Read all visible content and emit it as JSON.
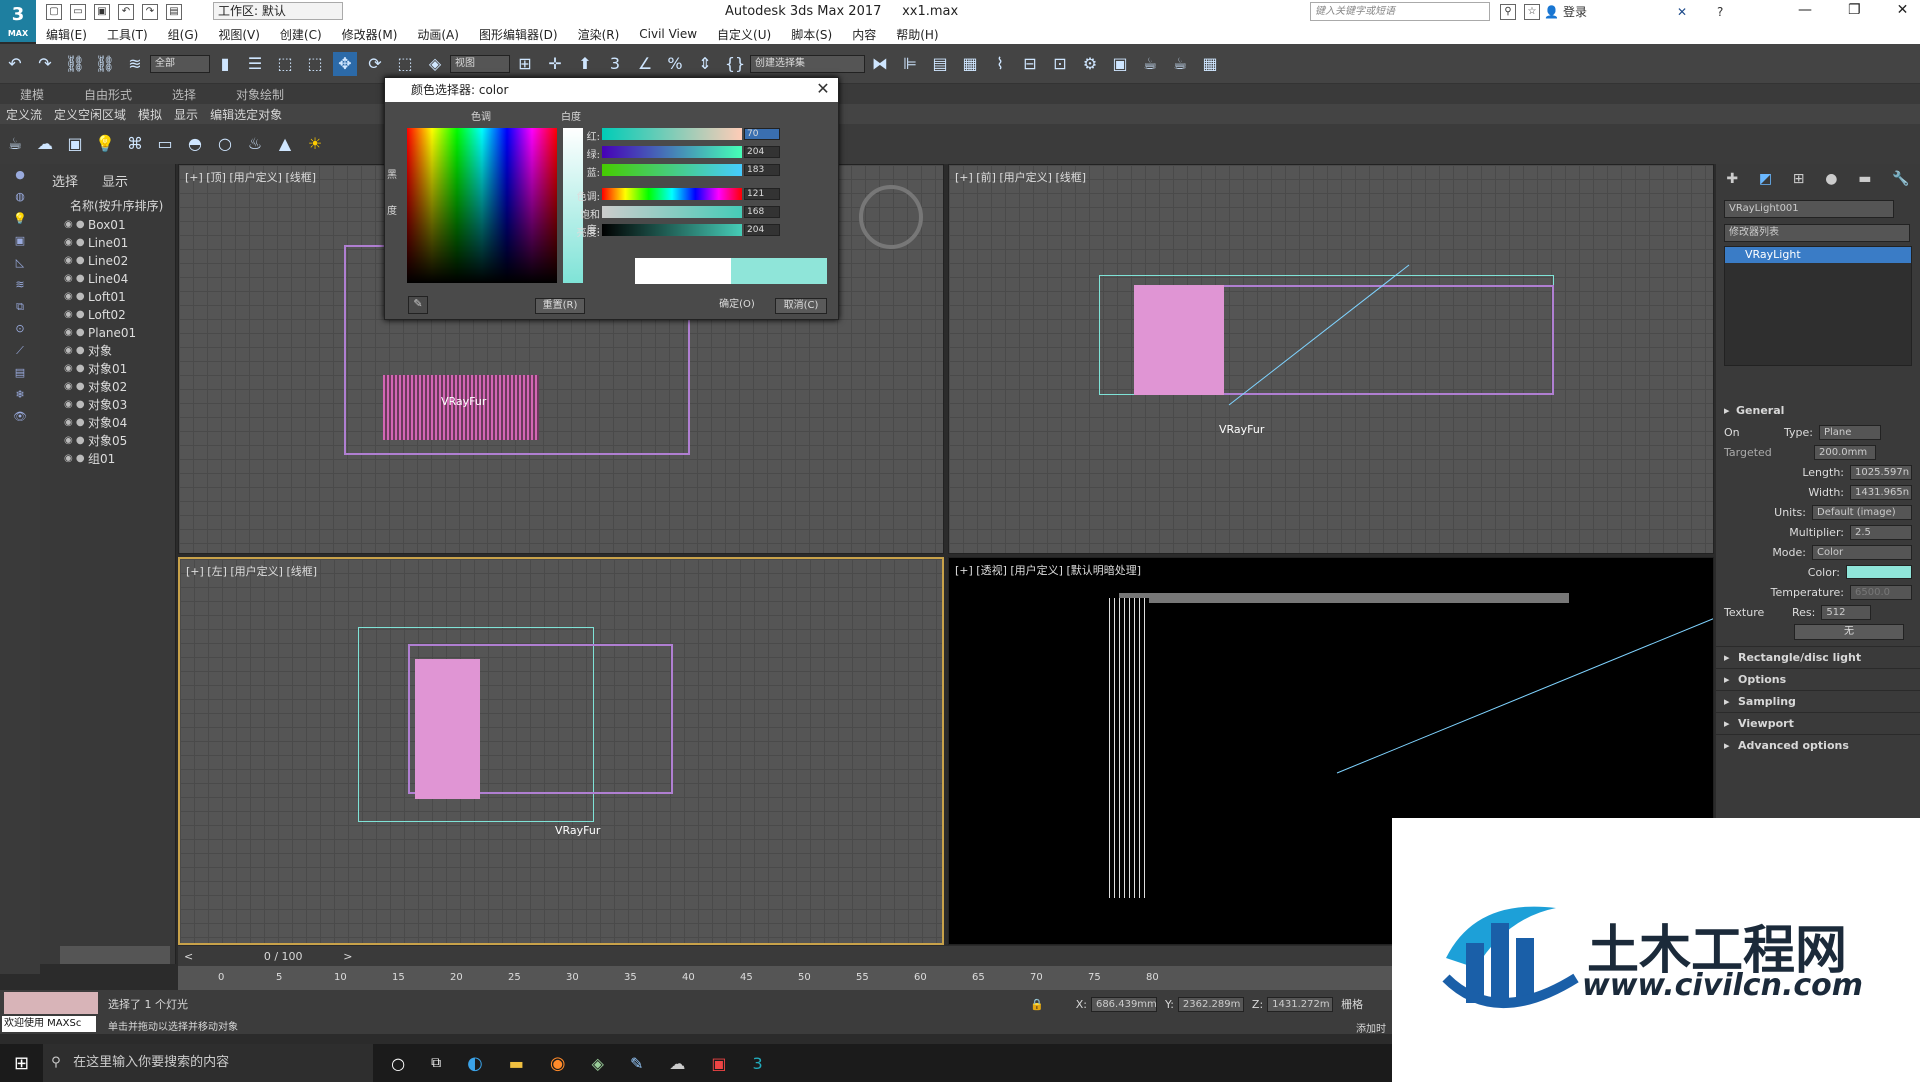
{
  "titlebar": {
    "logo": "3",
    "logo_sub": "MAX",
    "workspace": "工作区: 默认",
    "title": "Autodesk 3ds Max 2017",
    "file": "xx1.max",
    "search_placeholder": "键入关键字或短语",
    "login": "登录"
  },
  "menu": [
    "编辑(E)",
    "工具(T)",
    "组(G)",
    "视图(V)",
    "创建(C)",
    "修改器(M)",
    "动画(A)",
    "图形编辑器(D)",
    "渲染(R)",
    "Civil View",
    "自定义(U)",
    "脚本(S)",
    "内容",
    "帮助(H)"
  ],
  "toolbar": {
    "filter": "全部",
    "ref_coord": "视图",
    "selection_set": "创建选择集"
  },
  "ribbon_tabs": [
    "建模",
    "自由形式",
    "选择",
    "对象绘制"
  ],
  "ribbon_sub": [
    "定义流",
    "定义空闲区域",
    "模拟",
    "显示",
    "编辑选定对象"
  ],
  "scene_explorer": {
    "tabs": [
      "选择",
      "显示"
    ],
    "header": "名称(按升序排序)",
    "items": [
      "Box01",
      "Line01",
      "Line02",
      "Line04",
      "Loft01",
      "Loft02",
      "Plane01",
      "对象",
      "对象01",
      "对象02",
      "对象03",
      "对象04",
      "对象05",
      "组01"
    ]
  },
  "viewports": {
    "top": "[+] [顶] [用户定义] [线框]",
    "front": "[+] [前] [用户定义] [线框]",
    "left": "[+] [左] [用户定义] [线框]",
    "persp": "[+] [透视] [用户定义] [默认明暗处理]",
    "vrayfur": "VRayFur"
  },
  "color_dialog": {
    "title": "颜色选择器: color",
    "hue_label": "色调",
    "whiteness_label": "白度",
    "black_label": "黑",
    "degree_label": "度",
    "red_label": "红:",
    "red": "70",
    "green_label": "绿:",
    "green": "204",
    "blue_label": "蓝:",
    "blue": "183",
    "hue2_label": "色调:",
    "hue": "121",
    "sat_label": "饱和度:",
    "sat": "168",
    "val_label": "亮度:",
    "val": "204",
    "reset": "重置(R)",
    "ok": "确定(O)",
    "cancel": "取消(C)",
    "old_color": "#ffffff",
    "new_color": "#8fe5d9"
  },
  "command_panel": {
    "object_name": "VRayLight001",
    "modifier_list": "修改器列表",
    "stack_item": "VRayLight",
    "general": "General",
    "on": "On",
    "type_label": "Type:",
    "type": "Plane",
    "targeted": "Targeted",
    "targeted_val": "200.0mm",
    "length_label": "Length:",
    "length": "1025.597n",
    "width_label": "Width:",
    "width": "1431.965n",
    "units_label": "Units:",
    "units": "Default (image)",
    "mult_label": "Multiplier:",
    "mult": "2.5",
    "mode_label": "Mode:",
    "mode": "Color",
    "color_label": "Color:",
    "temp_label": "Temperature:",
    "temp": "6500.0",
    "texture": "Texture",
    "res_label": "Res:",
    "res": "512",
    "none": "无",
    "rollouts": [
      "Rectangle/disc light",
      "Options",
      "Sampling",
      "Viewport",
      "Advanced options"
    ]
  },
  "timeline": {
    "frame": "0 / 100",
    "ticks": [
      "0",
      "5",
      "10",
      "15",
      "20",
      "25",
      "30",
      "35",
      "40",
      "45",
      "50",
      "55",
      "60",
      "65",
      "70",
      "75",
      "80"
    ]
  },
  "status": {
    "welcome": "欢迎使用 MAXSc",
    "selected": "选择了 1 个灯光",
    "hint": "单击并拖动以选择并移动对象",
    "x_label": "X:",
    "x": "686.439mm",
    "y_label": "Y:",
    "y": "2362.289m",
    "z_label": "Z:",
    "z": "1431.272m",
    "grid": "栅格",
    "add": "添加时"
  },
  "taskbar": {
    "search": "在这里输入你要搜索的内容"
  },
  "watermark": {
    "cn": "土木工程网",
    "url": "www.civilcn.com"
  }
}
